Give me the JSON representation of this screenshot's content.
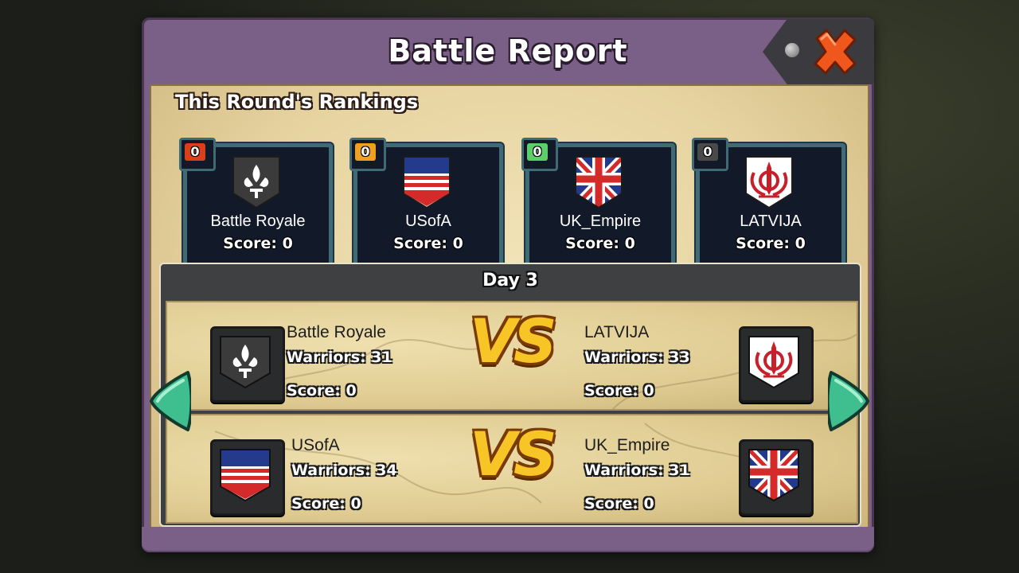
{
  "dialog": {
    "title": "Battle Report",
    "rankings_heading": "This Round's Rankings"
  },
  "rankings": [
    {
      "rank": "0",
      "badge_color": "#d9401a",
      "name": "Battle Royale",
      "score": "Score: 0",
      "flag": "fleur-de-lis-icon"
    },
    {
      "rank": "0",
      "badge_color": "#f0a020",
      "name": "USofA",
      "score": "Score: 0",
      "flag": "stripes-flag-icon"
    },
    {
      "rank": "0",
      "badge_color": "#5ccf6a",
      "name": "UK_Empire",
      "score": "Score: 0",
      "flag": "union-jack-icon"
    },
    {
      "rank": "0",
      "badge_color": "#4a4a4a",
      "name": "LATVIJA",
      "score": "Score: 0",
      "flag": "khanda-icon"
    }
  ],
  "day": {
    "label": "Day 3",
    "vs_text": "VS",
    "matches": [
      {
        "left": {
          "name": "Battle Royale",
          "warriors": "Warriors: 31",
          "score": "Score: 0",
          "flag": "fleur-de-lis-icon"
        },
        "right": {
          "name": "LATVIJA",
          "warriors": "Warriors: 33",
          "score": "Score: 0",
          "flag": "khanda-icon"
        }
      },
      {
        "left": {
          "name": "USofA",
          "warriors": "Warriors: 34",
          "score": "Score: 0",
          "flag": "stripes-flag-icon"
        },
        "right": {
          "name": "UK_Empire",
          "warriors": "Warriors: 31",
          "score": "Score: 0",
          "flag": "union-jack-icon"
        }
      }
    ]
  },
  "colors": {
    "frame": "#7a5f87",
    "card_border": "#3f6a76",
    "vs_gold": "#f7c526",
    "arrow_teal": "#3fbf90"
  }
}
